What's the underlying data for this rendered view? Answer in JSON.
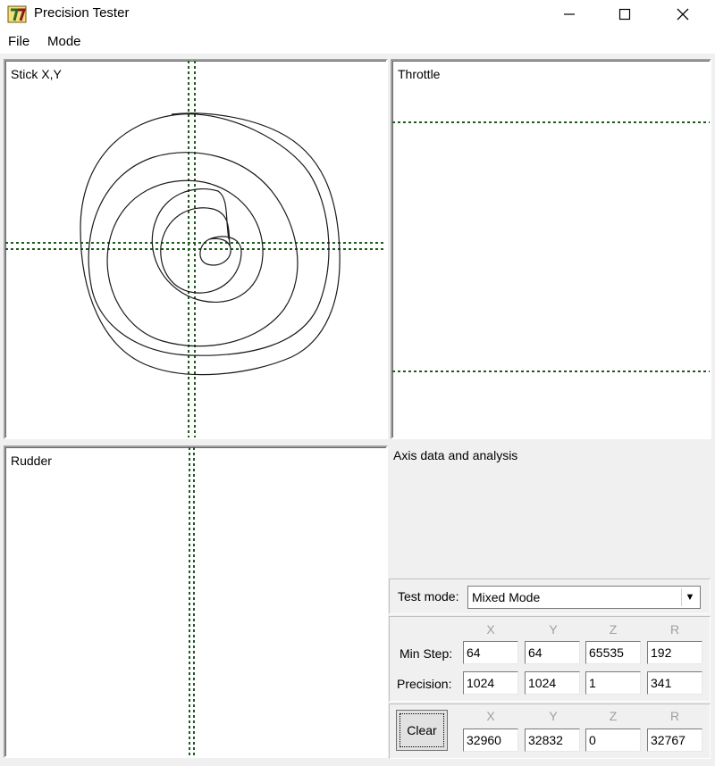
{
  "window": {
    "title": "Precision Tester"
  },
  "menu": {
    "file": "File",
    "mode": "Mode"
  },
  "panels": {
    "stick": "Stick X,Y",
    "throttle": "Throttle",
    "rudder": "Rudder",
    "analysis": "Axis data and analysis"
  },
  "test_mode": {
    "label": "Test mode:",
    "value": "Mixed Mode"
  },
  "table": {
    "columns": [
      "X",
      "Y",
      "Z",
      "R"
    ],
    "min_step_label": "Min Step:",
    "min_step": [
      "64",
      "64",
      "65535",
      "192"
    ],
    "precision_label": "Precision:",
    "precision": [
      "1024",
      "1024",
      "1",
      "341"
    ]
  },
  "current": {
    "clear_label": "Clear",
    "columns": [
      "X",
      "Y",
      "Z",
      "R"
    ],
    "values": [
      "32960",
      "32832",
      "0",
      "32767"
    ]
  },
  "colors": {
    "crosshair": "#1f5a1f",
    "trace": "#1a1a1a"
  }
}
